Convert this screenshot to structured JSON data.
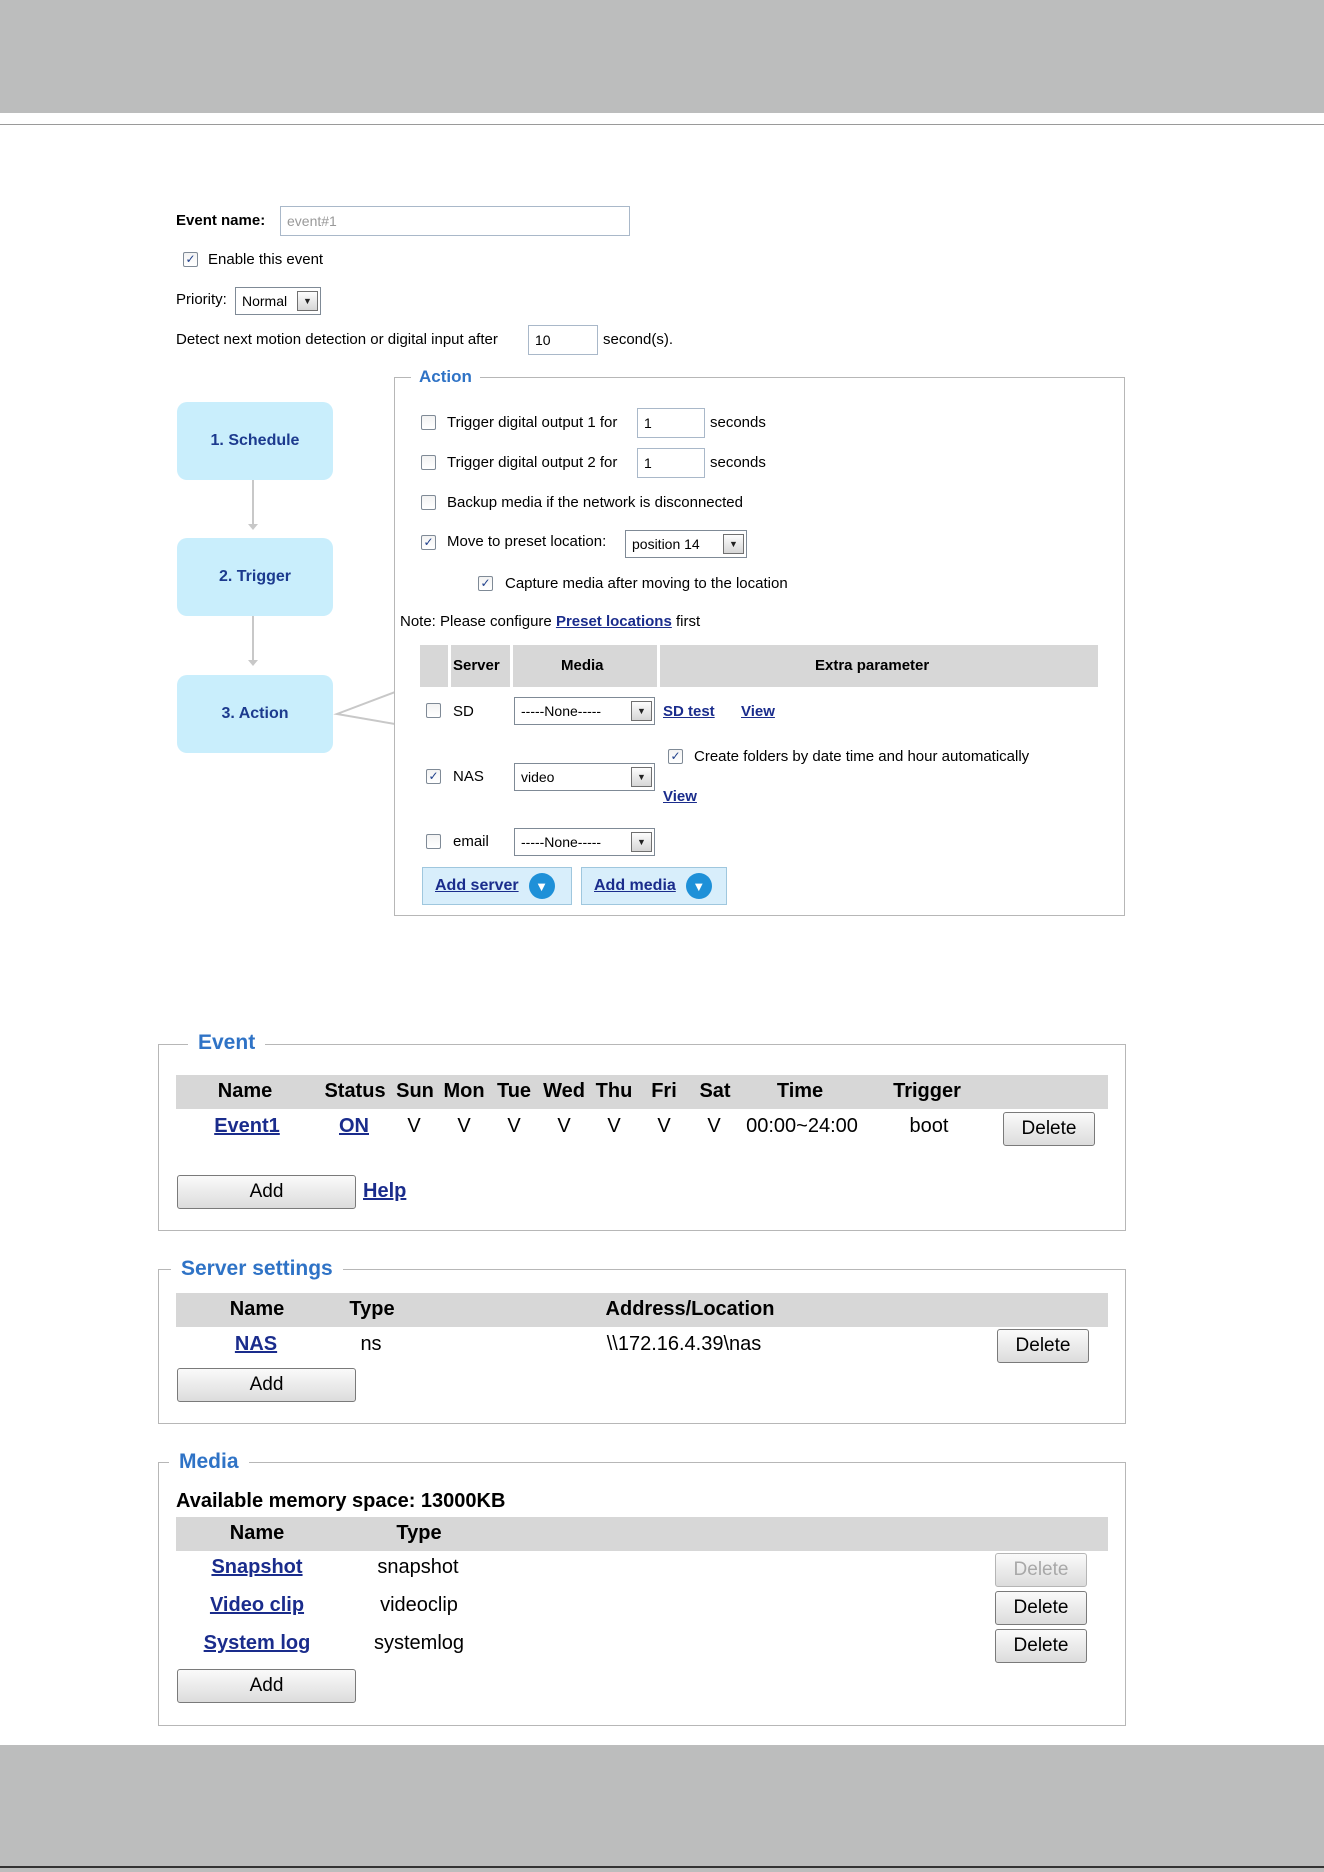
{
  "form": {
    "event_name_label": "Event name:",
    "event_name_value": "event#1",
    "enable_label": "Enable this event",
    "priority_label": "Priority:",
    "priority_value": "Normal",
    "detect_label": "Detect next motion detection or digital input after",
    "detect_value": "10",
    "detect_unit": "second(s)."
  },
  "flow": {
    "step1": "1.  Schedule",
    "step2": "2.  Trigger",
    "step3": "3.  Action"
  },
  "action": {
    "legend": "Action",
    "do1_label": "Trigger digital output 1 for",
    "do1_value": "1",
    "do1_unit": "seconds",
    "do2_label": "Trigger digital output 2 for",
    "do2_value": "1",
    "do2_unit": "seconds",
    "backup_label": "Backup media if the network is disconnected",
    "preset_label": "Move to preset location:",
    "preset_value": "position 14",
    "capture_label": "Capture media after moving to the location",
    "note_prefix": "Note: Please configure",
    "note_link": "Preset locations",
    "note_suffix": "first",
    "table_headers": {
      "server": "Server",
      "media": "Media",
      "extra": "Extra parameter"
    },
    "rows": {
      "sd": {
        "server": "SD",
        "media": "-----None-----",
        "link1": "SD test",
        "link2": "View"
      },
      "nas": {
        "server": "NAS",
        "media": "video",
        "extra_check": "Create folders by date time and hour automatically",
        "link": "View"
      },
      "email": {
        "server": "email",
        "media": "-----None-----"
      }
    },
    "add_server": "Add server",
    "add_media": "Add media"
  },
  "event_panel": {
    "legend": "Event",
    "headers": {
      "name": "Name",
      "status": "Status",
      "sun": "Sun",
      "mon": "Mon",
      "tue": "Tue",
      "wed": "Wed",
      "thu": "Thu",
      "fri": "Fri",
      "sat": "Sat",
      "time": "Time",
      "trigger": "Trigger"
    },
    "row": {
      "name": "Event1",
      "status": "ON",
      "sun": "V",
      "mon": "V",
      "tue": "V",
      "wed": "V",
      "thu": "V",
      "fri": "V",
      "sat": "V",
      "time": "00:00~24:00",
      "trigger": "boot",
      "delete": "Delete"
    },
    "add": "Add",
    "help": "Help"
  },
  "server_panel": {
    "legend": "Server settings",
    "headers": {
      "name": "Name",
      "type": "Type",
      "address": "Address/Location"
    },
    "row": {
      "name": "NAS",
      "type": "ns",
      "address": "\\\\172.16.4.39\\nas",
      "delete": "Delete"
    },
    "add": "Add"
  },
  "media_panel": {
    "legend": "Media",
    "memory": "Available memory space: 13000KB",
    "headers": {
      "name": "Name",
      "type": "Type"
    },
    "rows": [
      {
        "name": "Snapshot",
        "type": "snapshot",
        "delete": "Delete"
      },
      {
        "name": "Video clip",
        "type": "videoclip",
        "delete": "Delete"
      },
      {
        "name": "System log",
        "type": "systemlog",
        "delete": "Delete"
      }
    ],
    "add": "Add"
  },
  "colors": {
    "accent": "#2f73c6",
    "link": "#1a2c8c",
    "flow_box": "#c9eefc",
    "header_gray": "#d7d7d7"
  }
}
